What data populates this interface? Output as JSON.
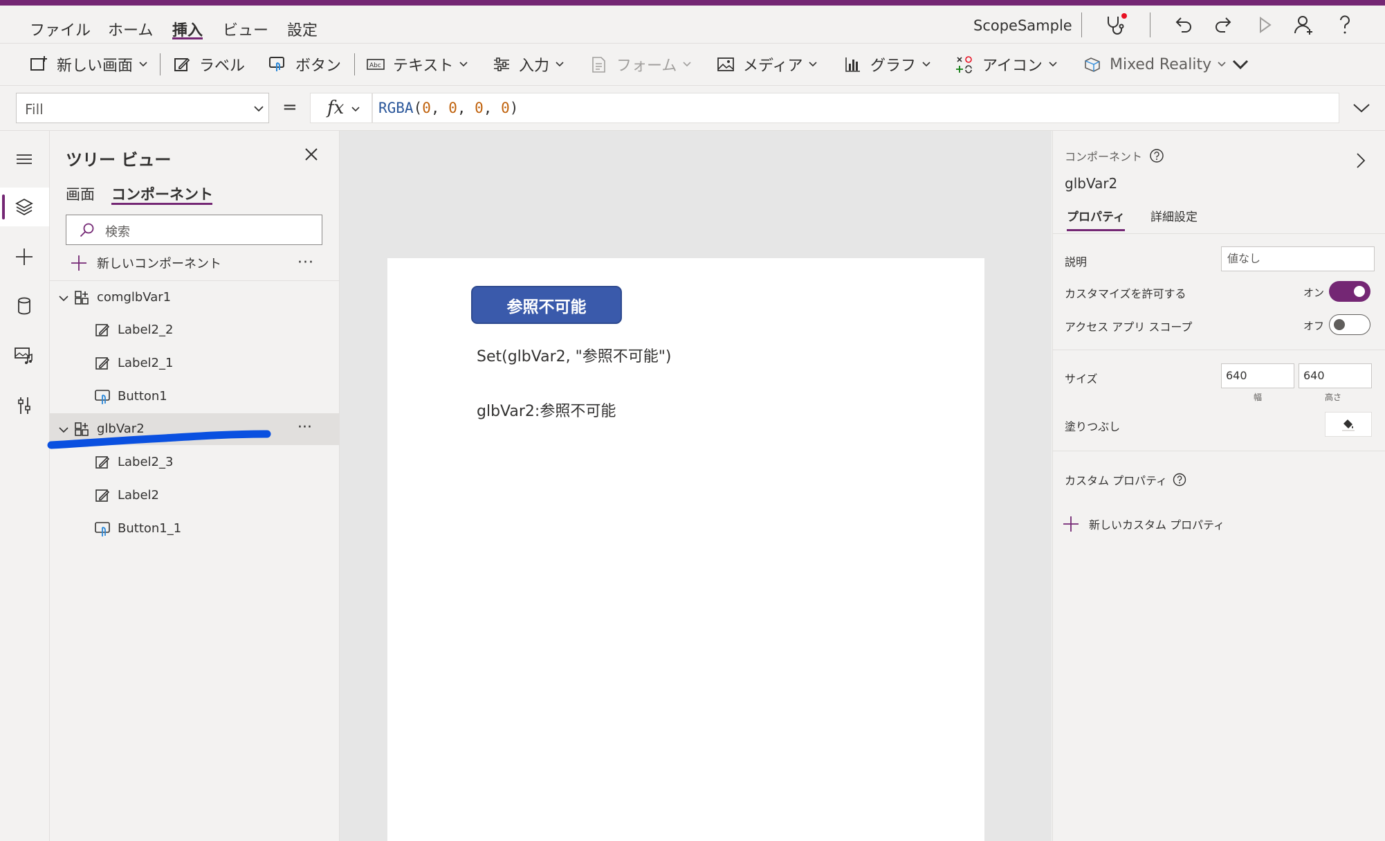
{
  "menu": {
    "items": [
      "ファイル",
      "ホーム",
      "挿入",
      "ビュー",
      "設定"
    ],
    "active_index": 2,
    "app_name": "ScopeSample"
  },
  "ribbon": {
    "new_screen": "新しい画面",
    "label": "ラベル",
    "button": "ボタン",
    "text": "テキスト",
    "input": "入力",
    "form": "フォーム",
    "media": "メディア",
    "chart": "グラフ",
    "icons": "アイコン",
    "mixed_reality": "Mixed Reality"
  },
  "formula": {
    "property": "Fill",
    "equals": "=",
    "fx": "fx",
    "fn_name": "RGBA",
    "args": [
      "0",
      "0",
      "0",
      "0"
    ]
  },
  "tree_view": {
    "title": "ツリー ビュー",
    "tabs": [
      "画面",
      "コンポーネント"
    ],
    "active_tab": 1,
    "search_placeholder": "検索",
    "new_component": "新しいコンポーネント",
    "more": "···",
    "nodes": [
      {
        "label": "comglbVar1",
        "kind": "component",
        "level": 0
      },
      {
        "label": "Label2_2",
        "kind": "label",
        "level": 1
      },
      {
        "label": "Label2_1",
        "kind": "label",
        "level": 1
      },
      {
        "label": "Button1",
        "kind": "button",
        "level": 1
      },
      {
        "label": "glbVar2",
        "kind": "component",
        "level": 0,
        "selected": true
      },
      {
        "label": "Label2_3",
        "kind": "label",
        "level": 1
      },
      {
        "label": "Label2",
        "kind": "label",
        "level": 1
      },
      {
        "label": "Button1_1",
        "kind": "button",
        "level": 1
      }
    ]
  },
  "canvas": {
    "button_text": "参照不可能",
    "label1": "Set(glbVar2, \"参照不可能\")",
    "label2": "glbVar2:参照不可能"
  },
  "properties": {
    "type_label": "コンポーネント",
    "name": "glbVar2",
    "tabs": [
      "プロパティ",
      "詳細設定"
    ],
    "active_tab": 0,
    "description_label": "説明",
    "description_placeholder": "値なし",
    "allow_customization_label": "カスタマイズを許可する",
    "allow_customization_state": "オン",
    "access_app_scope_label": "アクセス アプリ スコープ",
    "access_app_scope_state": "オフ",
    "size_label": "サイズ",
    "width": "640",
    "height": "640",
    "width_caption": "幅",
    "height_caption": "高さ",
    "fill_label": "塗りつぶし",
    "custom_properties_label": "カスタム プロパティ",
    "new_custom_property": "新しいカスタム プロパティ"
  },
  "colors": {
    "brand": "#742774",
    "button_fill": "#3a5aab",
    "annotation": "#0a50e0"
  }
}
